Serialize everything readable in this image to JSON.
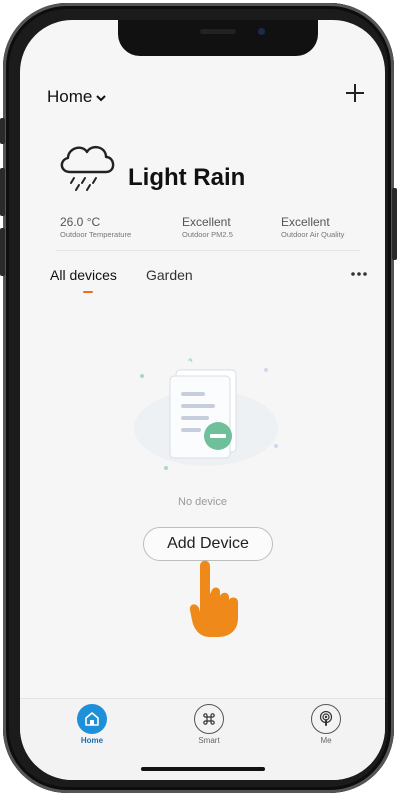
{
  "header": {
    "home_label": "Home",
    "add_icon": "plus-icon"
  },
  "weather": {
    "condition": "Light Rain",
    "icon": "cloud-rain-icon",
    "stats": [
      {
        "value": "26.0 °C",
        "label": "Outdoor Temperature"
      },
      {
        "value": "Excellent",
        "label": "Outdoor PM2.5"
      },
      {
        "value": "Excellent",
        "label": "Outdoor Air Quality"
      }
    ]
  },
  "tabs": {
    "active": "All devices",
    "other": "Garden",
    "more_icon": "more-icon"
  },
  "empty": {
    "message": "No device",
    "button": "Add Device"
  },
  "tabbar": [
    {
      "label": "Home",
      "icon": "home-icon",
      "active": true
    },
    {
      "label": "Smart",
      "icon": "command-icon",
      "active": false
    },
    {
      "label": "Me",
      "icon": "podcast-icon",
      "active": false
    }
  ],
  "colors": {
    "accent": "#1e8fd9",
    "tab_underline": "#f06b20",
    "hand": "#ef8a1a"
  }
}
